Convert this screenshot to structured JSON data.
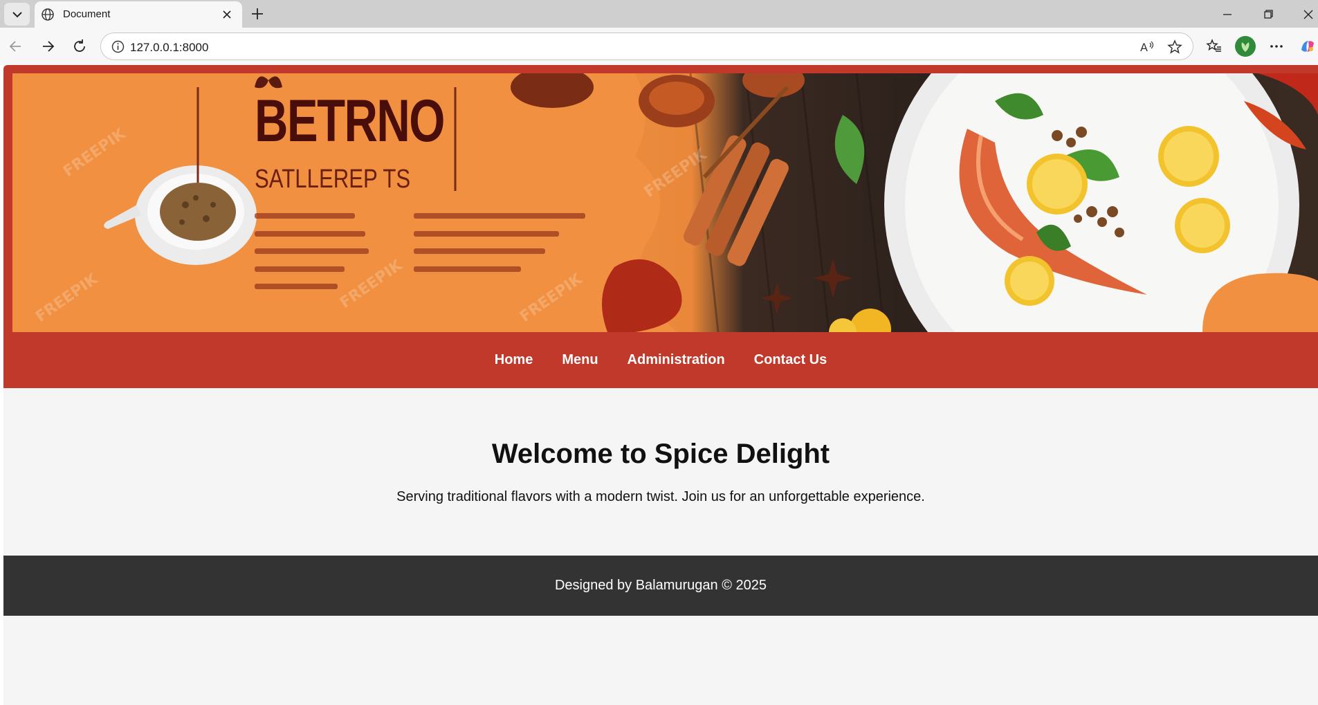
{
  "browser": {
    "tab_title": "Document",
    "url": "127.0.0.1:8000",
    "profile_color": "#2f8a3a"
  },
  "banner": {
    "brand_title": "BETRNO",
    "brand_subtitle": "SATLLEREP TS",
    "watermark": "FREEPIK"
  },
  "nav": {
    "items": [
      {
        "label": "Home"
      },
      {
        "label": "Menu"
      },
      {
        "label": "Administration"
      },
      {
        "label": "Contact Us"
      }
    ],
    "background": "#c0392b"
  },
  "main": {
    "heading": "Welcome to Spice Delight",
    "tagline": "Serving traditional flavors with a modern twist. Join us for an unforgettable experience."
  },
  "footer": {
    "text": "Designed by Balamurugan © 2025",
    "background": "#333333"
  },
  "icons": [
    "tab-list-icon",
    "globe-icon",
    "close-tab-icon",
    "new-tab-icon",
    "minimize-icon",
    "restore-icon",
    "close-window-icon",
    "back-icon",
    "forward-icon",
    "refresh-icon",
    "info-icon",
    "read-aloud-icon",
    "favorite-star-icon",
    "favorites-icon",
    "more-icon",
    "copilot-icon"
  ]
}
